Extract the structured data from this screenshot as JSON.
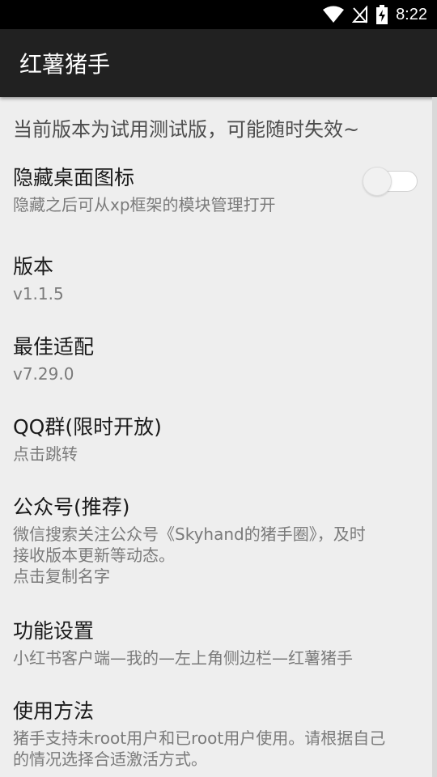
{
  "status_bar": {
    "time": "8:22"
  },
  "app_bar": {
    "title": "红薯猪手"
  },
  "notice": "当前版本为试用测试版，可能随时失效~",
  "prefs": {
    "hide_icon": {
      "title": "隐藏桌面图标",
      "summary": "隐藏之后可从xp框架的模块管理打开",
      "switch_on": false
    },
    "version": {
      "title": "版本",
      "summary": "v1.1.5"
    },
    "best_fit": {
      "title": "最佳适配",
      "summary": "v7.29.0"
    },
    "qq_group": {
      "title": "QQ群(限时开放)",
      "summary": "点击跳转"
    },
    "official_account": {
      "title": "公众号(推荐)",
      "summary": "微信搜索关注公众号《Skyhand的猪手圈》，及时\n接收版本更新等动态。\n点击复制名字"
    },
    "function_settings": {
      "title": "功能设置",
      "summary": "小红书客户端—我的—左上角侧边栏—红薯猪手"
    },
    "usage": {
      "title": "使用方法",
      "summary": "猪手支持未root用户和已root用户使用。请根据自己\n的情况选择合适激活方式。"
    }
  }
}
